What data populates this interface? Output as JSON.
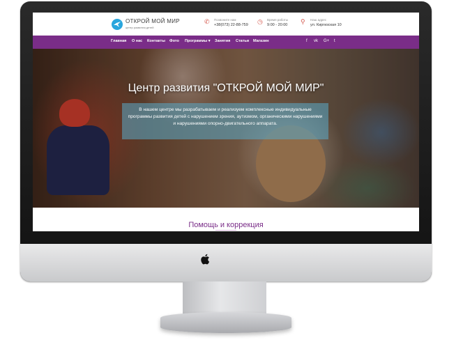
{
  "site": {
    "logo_name": "ОТКРОЙ МОЙ МИР",
    "logo_sub": "центр развития детей"
  },
  "contacts": [
    {
      "icon": "phone-icon",
      "label": "Позвоните нам",
      "value": "+38(073) 22-88-759"
    },
    {
      "icon": "clock-icon",
      "label": "Время работы",
      "value": "9:00 - 20:00"
    },
    {
      "icon": "location-pin-icon",
      "label": "Наш адрес",
      "value": "ул. Киргизская 10"
    }
  ],
  "nav": {
    "items": [
      "Главная",
      "О нас",
      "Контакты",
      "Фото",
      "Программы",
      "Занятия",
      "Статьи",
      "Магазин"
    ],
    "dropdown_marker": "▾"
  },
  "social": [
    "f",
    "vk",
    "G+",
    "t"
  ],
  "hero": {
    "title": "Центр развития \"ОТКРОЙ МОЙ МИР\"",
    "description": "В нашем центре мы разрабатываем и реализуем комплексные индивидуальные программы развития детей с нарушением зрения, аутизмом, органическими нарушениями и нарушениями опорно-двигательного аппарата."
  },
  "section": {
    "title": "Помощь и коррекция"
  },
  "colors": {
    "brand_purple": "#7a2d88",
    "accent_red": "#d4574c",
    "logo_blue": "#2aa6dd"
  }
}
